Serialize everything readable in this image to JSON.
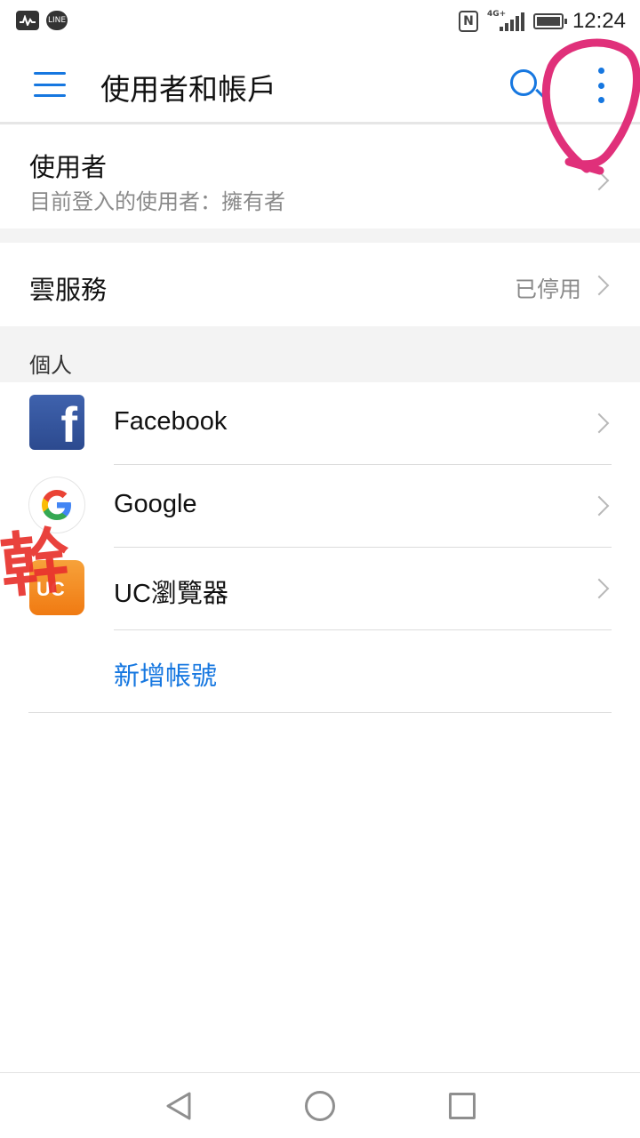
{
  "status_bar": {
    "time": "12:24",
    "network": "4G+",
    "left_icons": [
      "activity-icon",
      "line-app-icon"
    ],
    "line_label": "LINE",
    "right_icons": [
      "nfc-icon",
      "signal-icon",
      "battery-icon"
    ]
  },
  "app_bar": {
    "title": "使用者和帳戶",
    "icons": [
      "menu-icon",
      "search-icon",
      "more-options-icon"
    ],
    "accent_color": "#1677e0"
  },
  "users": {
    "title": "使用者",
    "subtitle": "目前登入的使用者：擁有者"
  },
  "cloud": {
    "title": "雲服務",
    "value": "已停用"
  },
  "personal": {
    "header": "個人",
    "accounts": [
      {
        "label": "Facebook",
        "icon": "facebook-icon"
      },
      {
        "label": "Google",
        "icon": "google-icon"
      },
      {
        "label": "UC瀏覽器",
        "icon": "uc-browser-icon"
      }
    ],
    "add_account": "新增帳號"
  },
  "annotations": {
    "stamp_text": "幹",
    "circle_color": "#e0307a"
  },
  "nav_bar": {
    "icons": [
      "back-icon",
      "home-icon",
      "recents-icon"
    ]
  }
}
